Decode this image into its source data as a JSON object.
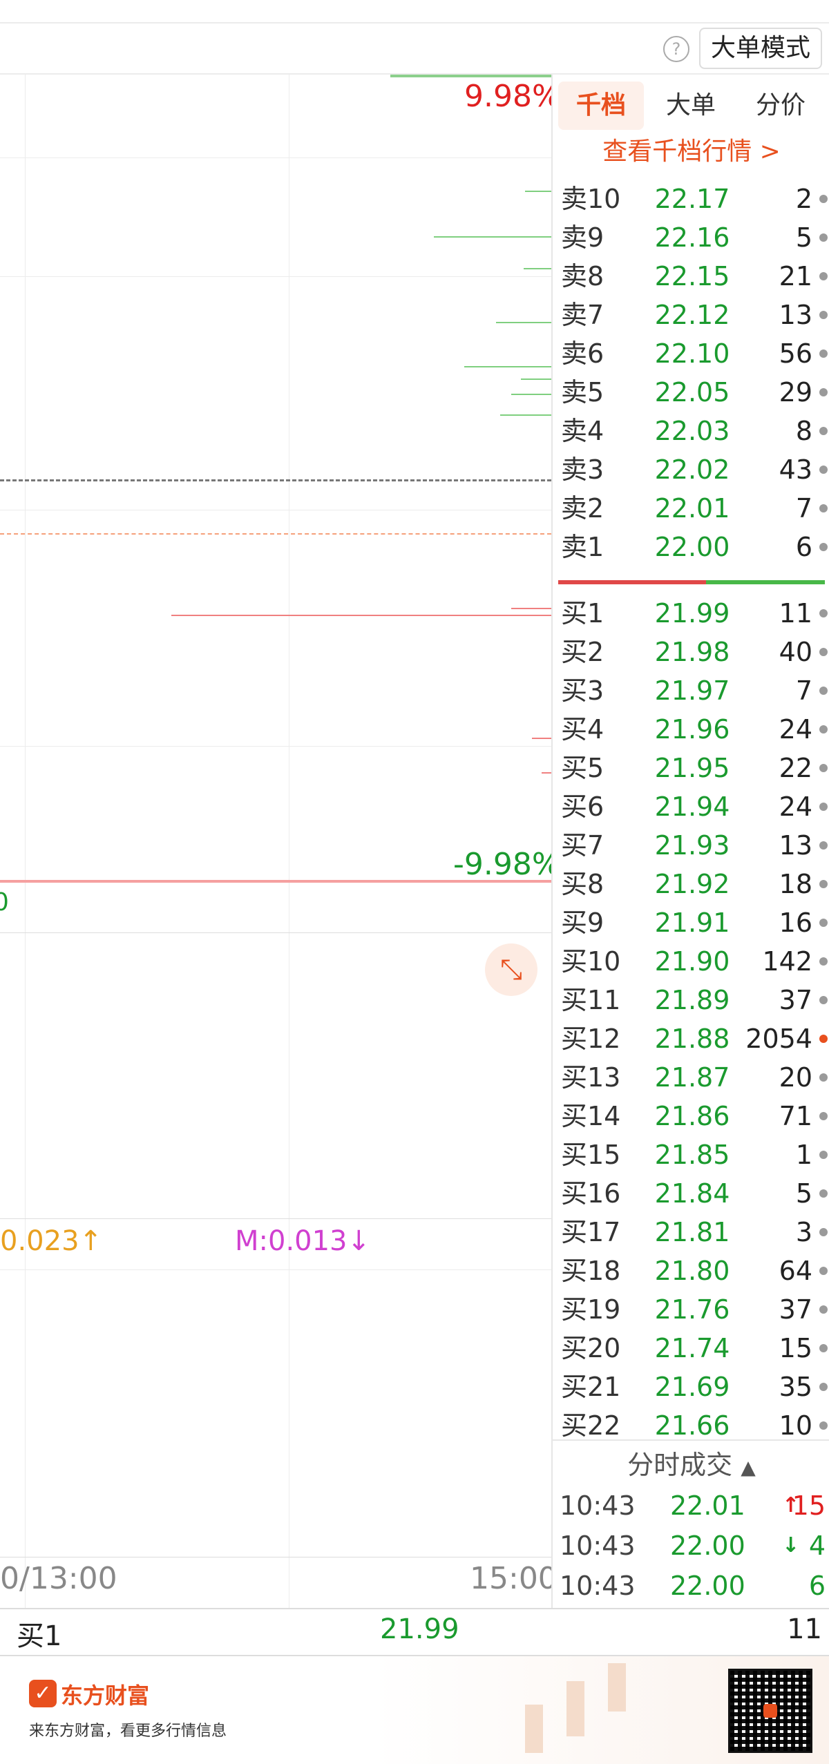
{
  "toolbar": {
    "help_label": "?",
    "mode_button": "大单模式"
  },
  "chart": {
    "pct_high": "9.98%",
    "pct_low": "-9.98%",
    "indicator_a": "0.023↑",
    "indicator_m": "M:0.013↓",
    "time_mid": "0/13:00",
    "time_end": "15:00",
    "fragment_left": "0"
  },
  "panel": {
    "tabs": [
      "千档",
      "大单",
      "分价"
    ],
    "view_link": "查看千档行情 >",
    "sells": [
      {
        "label": "卖10",
        "price": "22.17",
        "vol": "2"
      },
      {
        "label": "卖9",
        "price": "22.16",
        "vol": "5"
      },
      {
        "label": "卖8",
        "price": "22.15",
        "vol": "21"
      },
      {
        "label": "卖7",
        "price": "22.12",
        "vol": "13"
      },
      {
        "label": "卖6",
        "price": "22.10",
        "vol": "56"
      },
      {
        "label": "卖5",
        "price": "22.05",
        "vol": "29"
      },
      {
        "label": "卖4",
        "price": "22.03",
        "vol": "8"
      },
      {
        "label": "卖3",
        "price": "22.02",
        "vol": "43"
      },
      {
        "label": "卖2",
        "price": "22.01",
        "vol": "7"
      },
      {
        "label": "卖1",
        "price": "22.00",
        "vol": "6"
      }
    ],
    "buys": [
      {
        "label": "买1",
        "price": "21.99",
        "vol": "11"
      },
      {
        "label": "买2",
        "price": "21.98",
        "vol": "40"
      },
      {
        "label": "买3",
        "price": "21.97",
        "vol": "7"
      },
      {
        "label": "买4",
        "price": "21.96",
        "vol": "24"
      },
      {
        "label": "买5",
        "price": "21.95",
        "vol": "22"
      },
      {
        "label": "买6",
        "price": "21.94",
        "vol": "24"
      },
      {
        "label": "买7",
        "price": "21.93",
        "vol": "13"
      },
      {
        "label": "买8",
        "price": "21.92",
        "vol": "18"
      },
      {
        "label": "买9",
        "price": "21.91",
        "vol": "16"
      },
      {
        "label": "买10",
        "price": "21.90",
        "vol": "142"
      },
      {
        "label": "买11",
        "price": "21.89",
        "vol": "37"
      },
      {
        "label": "买12",
        "price": "21.88",
        "vol": "2054"
      },
      {
        "label": "买13",
        "price": "21.87",
        "vol": "20"
      },
      {
        "label": "买14",
        "price": "21.86",
        "vol": "71"
      },
      {
        "label": "买15",
        "price": "21.85",
        "vol": "1"
      },
      {
        "label": "买16",
        "price": "21.84",
        "vol": "5"
      },
      {
        "label": "买17",
        "price": "21.81",
        "vol": "3"
      },
      {
        "label": "买18",
        "price": "21.80",
        "vol": "64"
      },
      {
        "label": "买19",
        "price": "21.76",
        "vol": "37"
      },
      {
        "label": "买20",
        "price": "21.74",
        "vol": "15"
      },
      {
        "label": "买21",
        "price": "21.69",
        "vol": "35"
      },
      {
        "label": "买22",
        "price": "21.66",
        "vol": "10"
      }
    ],
    "trades_title": "分时成交",
    "trades": [
      {
        "time": "10:43",
        "price": "22.01",
        "arrow": "↑",
        "vol": "15",
        "arrow_color": "#e02020",
        "vol_color": "#e02020"
      },
      {
        "time": "10:43",
        "price": "22.00",
        "arrow": "↓",
        "vol": "4",
        "arrow_color": "#1a9a2e",
        "vol_color": "#1a9a2e"
      },
      {
        "time": "10:43",
        "price": "22.00",
        "arrow": "",
        "vol": "6",
        "arrow_color": "#1a9a2e",
        "vol_color": "#1a9a2e"
      }
    ]
  },
  "bottom_row": {
    "label": "买1",
    "price": "21.99",
    "vol": "11"
  },
  "footer": {
    "brand": "东方财富",
    "slogan": "来东方财富，看更多行情信息"
  },
  "colors": {
    "accent": "#e8501e",
    "up": "#e02020",
    "down": "#1a9a2e"
  }
}
